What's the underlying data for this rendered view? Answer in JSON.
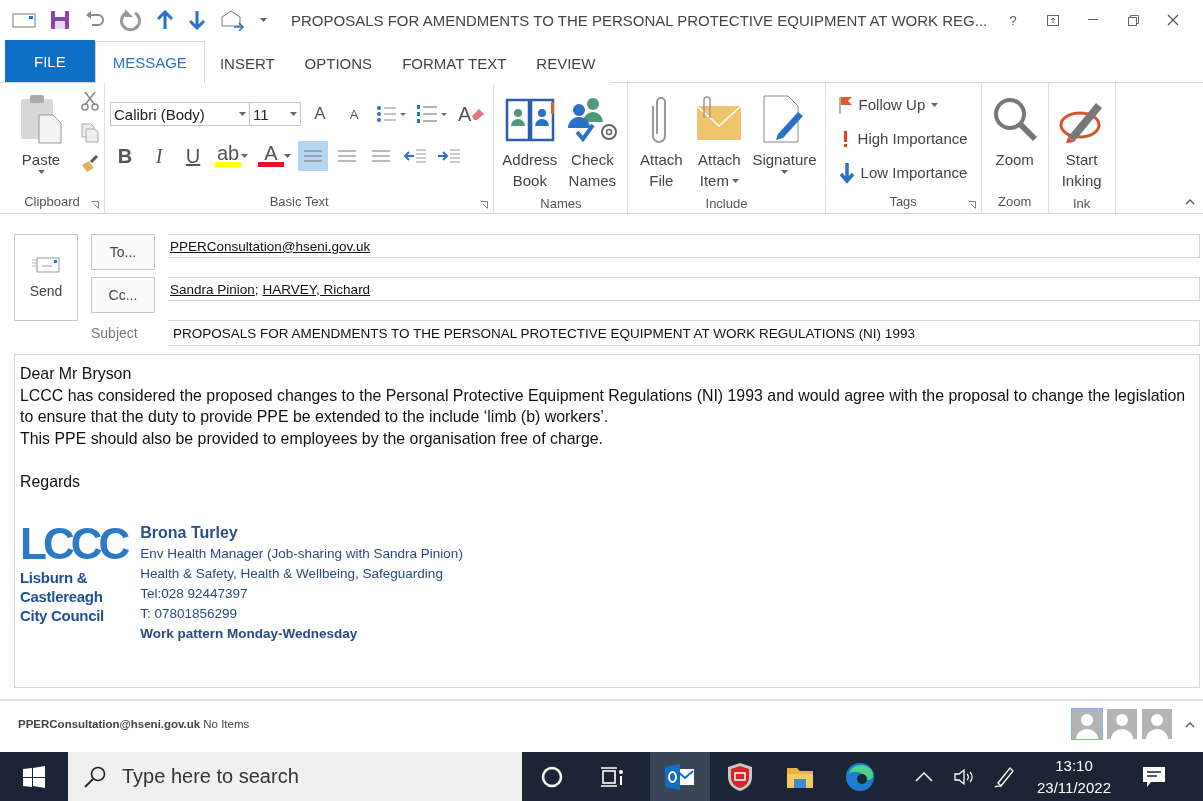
{
  "window": {
    "title": "PROPOSALS FOR AMENDMENTS TO THE PERSONAL PROTECTIVE EQUIPMENT AT WORK REG...",
    "help": "?"
  },
  "tabs": [
    {
      "label": "FILE",
      "kind": "file",
      "selected": false
    },
    {
      "label": "MESSAGE",
      "kind": "tab",
      "selected": true
    },
    {
      "label": "INSERT",
      "kind": "tab",
      "selected": false
    },
    {
      "label": "OPTIONS",
      "kind": "tab",
      "selected": false
    },
    {
      "label": "FORMAT TEXT",
      "kind": "tab",
      "selected": false
    },
    {
      "label": "REVIEW",
      "kind": "tab",
      "selected": false
    }
  ],
  "ribbon": {
    "groups": [
      {
        "kind": "clipboard",
        "label": "Clipboard",
        "launcher": true,
        "paste": {
          "label": "Paste",
          "dropdown": true
        }
      },
      {
        "kind": "basic_text",
        "label": "Basic Text",
        "launcher": true,
        "font": "Calibri (Body)",
        "size": "11",
        "row1": [
          {
            "kind": "grow",
            "label": "A"
          },
          {
            "kind": "shrink",
            "label": "A"
          },
          {
            "kind": "bullets"
          },
          {
            "kind": "numbering"
          },
          {
            "kind": "clear",
            "label": "A"
          }
        ],
        "row2": [
          {
            "kind": "bold",
            "label": "B"
          },
          {
            "kind": "italic",
            "label": "I"
          },
          {
            "kind": "underline",
            "label": "U"
          },
          {
            "kind": "highlight",
            "label": "ab",
            "color": "#ffff00"
          },
          {
            "kind": "font_color",
            "label": "A",
            "color": "#e81123"
          },
          {
            "kind": "align",
            "selected": true
          },
          {
            "kind": "align",
            "selected": false
          },
          {
            "kind": "align",
            "selected": false
          },
          {
            "kind": "outdent"
          },
          {
            "kind": "indent"
          }
        ]
      },
      {
        "kind": "buttons",
        "label": "Names",
        "buttons": [
          {
            "kind": "address_book",
            "lines": [
              "Address",
              "Book"
            ]
          },
          {
            "kind": "check_names",
            "lines": [
              "Check",
              "Names"
            ]
          }
        ]
      },
      {
        "kind": "buttons",
        "label": "Include",
        "buttons": [
          {
            "kind": "attach_file",
            "lines": [
              "Attach",
              "File"
            ]
          },
          {
            "kind": "attach_item",
            "lines": [
              "Attach",
              "Item"
            ],
            "dropdown": true
          },
          {
            "kind": "signature",
            "lines": [
              "Signature"
            ],
            "dropdown": true
          }
        ]
      },
      {
        "kind": "tags",
        "label": "Tags",
        "launcher": true,
        "rows": [
          {
            "kind": "flag",
            "label": "Follow Up",
            "dropdown": true
          },
          {
            "kind": "high",
            "label": "High Importance"
          },
          {
            "kind": "low",
            "label": "Low Importance"
          }
        ]
      },
      {
        "kind": "buttons",
        "label": "Zoom",
        "buttons": [
          {
            "kind": "zoom",
            "lines": [
              "Zoom"
            ]
          }
        ]
      },
      {
        "kind": "buttons",
        "label": "Ink",
        "buttons": [
          {
            "kind": "inking",
            "lines": [
              "Start",
              "Inking"
            ]
          }
        ]
      }
    ]
  },
  "compose": {
    "send": "Send",
    "to": {
      "button": "To...",
      "recipients": [
        "PPERConsultation@hseni.gov.uk"
      ]
    },
    "cc": {
      "button": "Cc...",
      "recipients": [
        "Sandra Pinion",
        "HARVEY, Richard"
      ],
      "separator": ";"
    },
    "subject": {
      "label": "Subject",
      "value": "PROPOSALS FOR AMENDMENTS TO THE PERSONAL PROTECTIVE EQUIPMENT AT WORK REGULATIONS (NI) 1993"
    }
  },
  "body": {
    "paragraphs": [
      [
        "Dear Mr Bryson",
        "LCCC has considered the proposed changes to the Personal Protective Equipment Regulations (NI) 1993 and would agree with the proposal to change the legislation to ensure that the duty to provide PPE be extended to the include ‘limb (b) workers’.",
        "This PPE should also  be provided to employees by the organisation free of charge."
      ],
      [
        "Regards"
      ]
    ],
    "signature": {
      "logo": {
        "mark": "LCCC",
        "lines": [
          "Lisburn &",
          "Castlereagh",
          "City Council"
        ]
      },
      "name": "Brona Turley",
      "lines": [
        "Env Health Manager (Job-sharing with Sandra Pinion)",
        "Health & Safety, Health & Wellbeing, Safeguarding",
        "Tel:028 92447397",
        "T: 07801856299"
      ],
      "work_pattern": "Work pattern Monday-Wednesday"
    }
  },
  "status_bar": {
    "sender": "PPERConsultation@hseni.gov.uk",
    "items": "No Items",
    "people": [
      {
        "selected": true
      },
      {
        "selected": false
      },
      {
        "selected": false
      }
    ]
  },
  "taskbar": {
    "search_placeholder": "Type here to search",
    "apps": [
      {
        "kind": "cortana",
        "active": false
      },
      {
        "kind": "task_view",
        "active": false
      },
      {
        "kind": "outlook",
        "active": true
      },
      {
        "kind": "shield",
        "active": false
      },
      {
        "kind": "folder",
        "active": false
      },
      {
        "kind": "edge",
        "active": false
      }
    ],
    "time": "13:10",
    "date": "23/11/2022"
  }
}
